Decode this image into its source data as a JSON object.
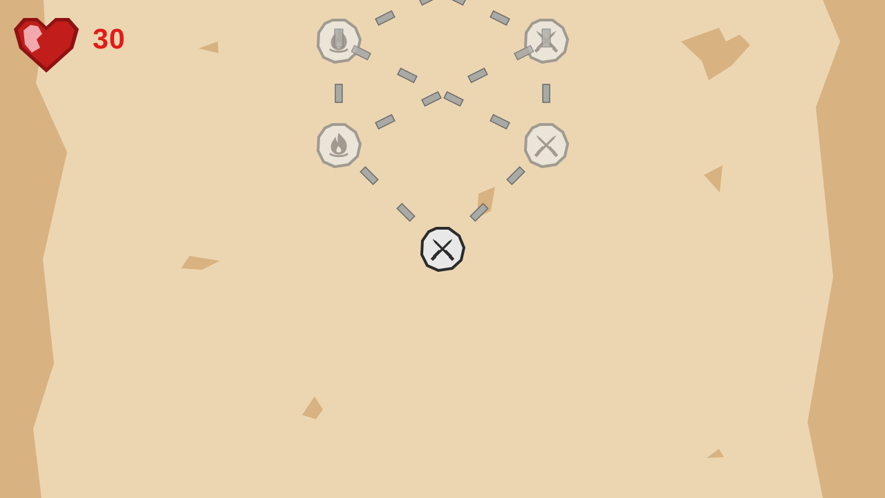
{
  "colors": {
    "parchment": "#ecd6b2",
    "parchment_edge": "#d8b281",
    "path_dash": "#a9a9a5",
    "node_locked_fill": "#ebe4d9",
    "node_locked_stroke": "#a19a90",
    "node_active_fill": "#e8e8e8",
    "node_active_stroke": "#2b2b2b",
    "health_red": "#e21b16",
    "heart_dark": "#8f1212",
    "heart_main": "#c01d1b",
    "heart_highlight": "#f2a9ad"
  },
  "hud": {
    "health_icon": "heart-icon",
    "health_value": "30"
  },
  "map": {
    "nodes": [
      {
        "id": "node-start",
        "kind": "battle",
        "icon": "crossed-swords-icon",
        "state": "current"
      },
      {
        "id": "node-left-1",
        "kind": "campfire",
        "icon": "campfire-icon",
        "state": "locked"
      },
      {
        "id": "node-right-1",
        "kind": "battle",
        "icon": "crossed-swords-icon",
        "state": "locked"
      },
      {
        "id": "node-left-2",
        "kind": "campfire",
        "icon": "campfire-icon",
        "state": "locked"
      },
      {
        "id": "node-right-2",
        "kind": "battle",
        "icon": "crossed-swords-icon",
        "state": "locked"
      }
    ]
  }
}
